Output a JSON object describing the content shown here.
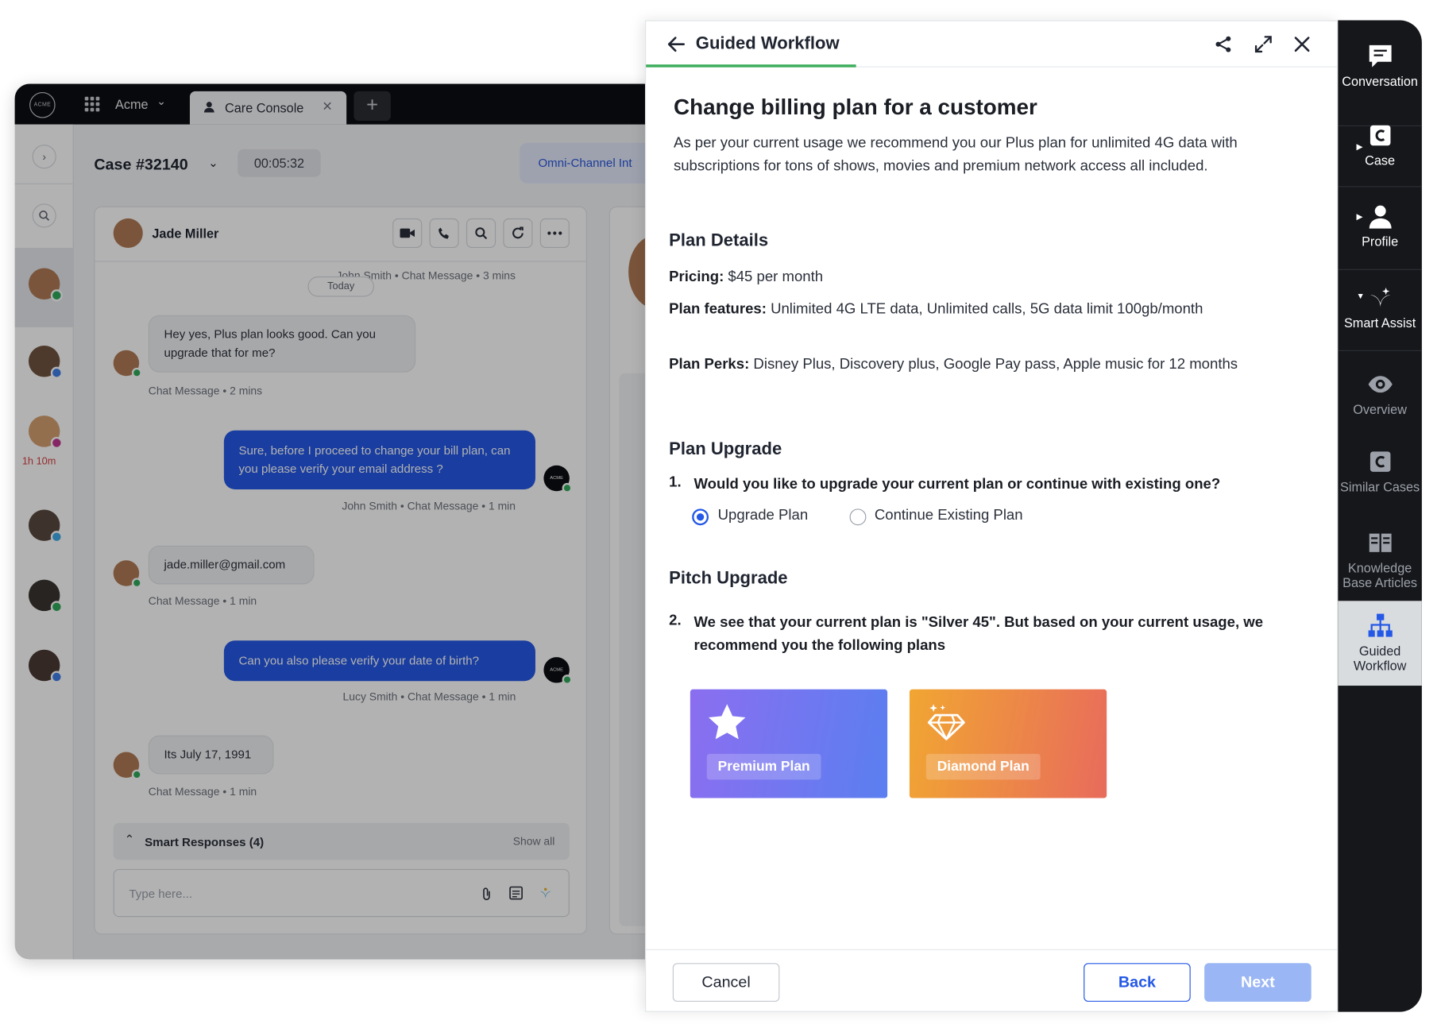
{
  "console": {
    "org_logo": "ACME",
    "org_name": "Acme",
    "tab_label": "Care Console",
    "case_title": "Case #32140",
    "case_timer": "00:05:32",
    "omni_label": "Omni-Channel Int",
    "rail_timer": "1h 10m",
    "contact_name": "Jade Miller",
    "partial_meta": "John Smith • Chat Message • 3 mins",
    "today_pill": "Today",
    "messages": [
      {
        "text": "Hey yes, Plus plan looks good. Can you upgrade that for me?",
        "meta": "Chat Message • 2 mins"
      },
      {
        "text": "Sure, before I proceed to change your bill plan, can you please verify your email address ?",
        "meta": "John Smith • Chat Message • 1 min"
      },
      {
        "text": "jade.miller@gmail.com",
        "meta": "Chat Message • 1 min"
      },
      {
        "text": "Can you also please verify your date of birth?",
        "meta": "Lucy Smith • Chat Message • 1 min"
      },
      {
        "text": "Its July 17, 1991",
        "meta": "Chat Message • 1 min"
      }
    ],
    "smart_responses": "Smart Responses (4)",
    "show_all": "Show all",
    "input_placeholder": "Type here..."
  },
  "panel": {
    "title": "Guided Workflow",
    "heading": "Change billing plan for a customer",
    "description": "As per your current usage we recommend you our Plus plan for unlimited 4G data with subscriptions for tons of shows, movies and premium network access all included.",
    "plan_details_title": "Plan Details",
    "pricing_label": "Pricing:",
    "pricing_value": "$45 per month",
    "features_label": "Plan features:",
    "features_value": "Unlimited 4G LTE data, Unlimited calls, 5G data limit 100gb/month",
    "perks_label": "Plan Perks:",
    "perks_value": "Disney Plus, Discovery plus, Google Pay pass, Apple music for 12 months",
    "upgrade_title": "Plan Upgrade",
    "q1_num": "1.",
    "q1_text": "Would you like to upgrade your current plan or continue with existing one?",
    "option_upgrade": "Upgrade Plan",
    "option_continue": "Continue Existing Plan",
    "selected_option": "Upgrade Plan",
    "pitch_title": "Pitch Upgrade",
    "q2_num": "2.",
    "q2_text": "We see that your current plan is \"Silver 45\". But based on your current usage, we recommend you the following plans",
    "plans": [
      {
        "label": "Premium Plan",
        "icon": "star-icon"
      },
      {
        "label": "Diamond Plan",
        "icon": "diamond-icon"
      }
    ],
    "cancel_label": "Cancel",
    "back_label": "Back",
    "next_label": "Next"
  },
  "sidebar": {
    "items": [
      {
        "label": "Conversation",
        "icon": "chat-icon"
      },
      {
        "label": "Case",
        "icon": "case-icon"
      },
      {
        "label": "Profile",
        "icon": "profile-icon"
      },
      {
        "label": "Smart Assist",
        "icon": "smart-assist-icon"
      },
      {
        "label": "Overview",
        "icon": "eye-icon"
      },
      {
        "label": "Similar Cases",
        "icon": "similar-cases-icon"
      },
      {
        "label": "Knowledge Base Articles",
        "icon": "book-icon"
      },
      {
        "label": "Guided Workflow",
        "icon": "workflow-icon"
      }
    ],
    "active": "Guided Workflow"
  },
  "colors": {
    "primary": "#2458e6",
    "accent_green": "#3dae5c",
    "sidebar_bg": "#15171b",
    "premium_gradient_start": "#8b6ef0",
    "premium_gradient_end": "#5a7ff0",
    "diamond_gradient_start": "#f1a632",
    "diamond_gradient_end": "#e86b5c"
  }
}
